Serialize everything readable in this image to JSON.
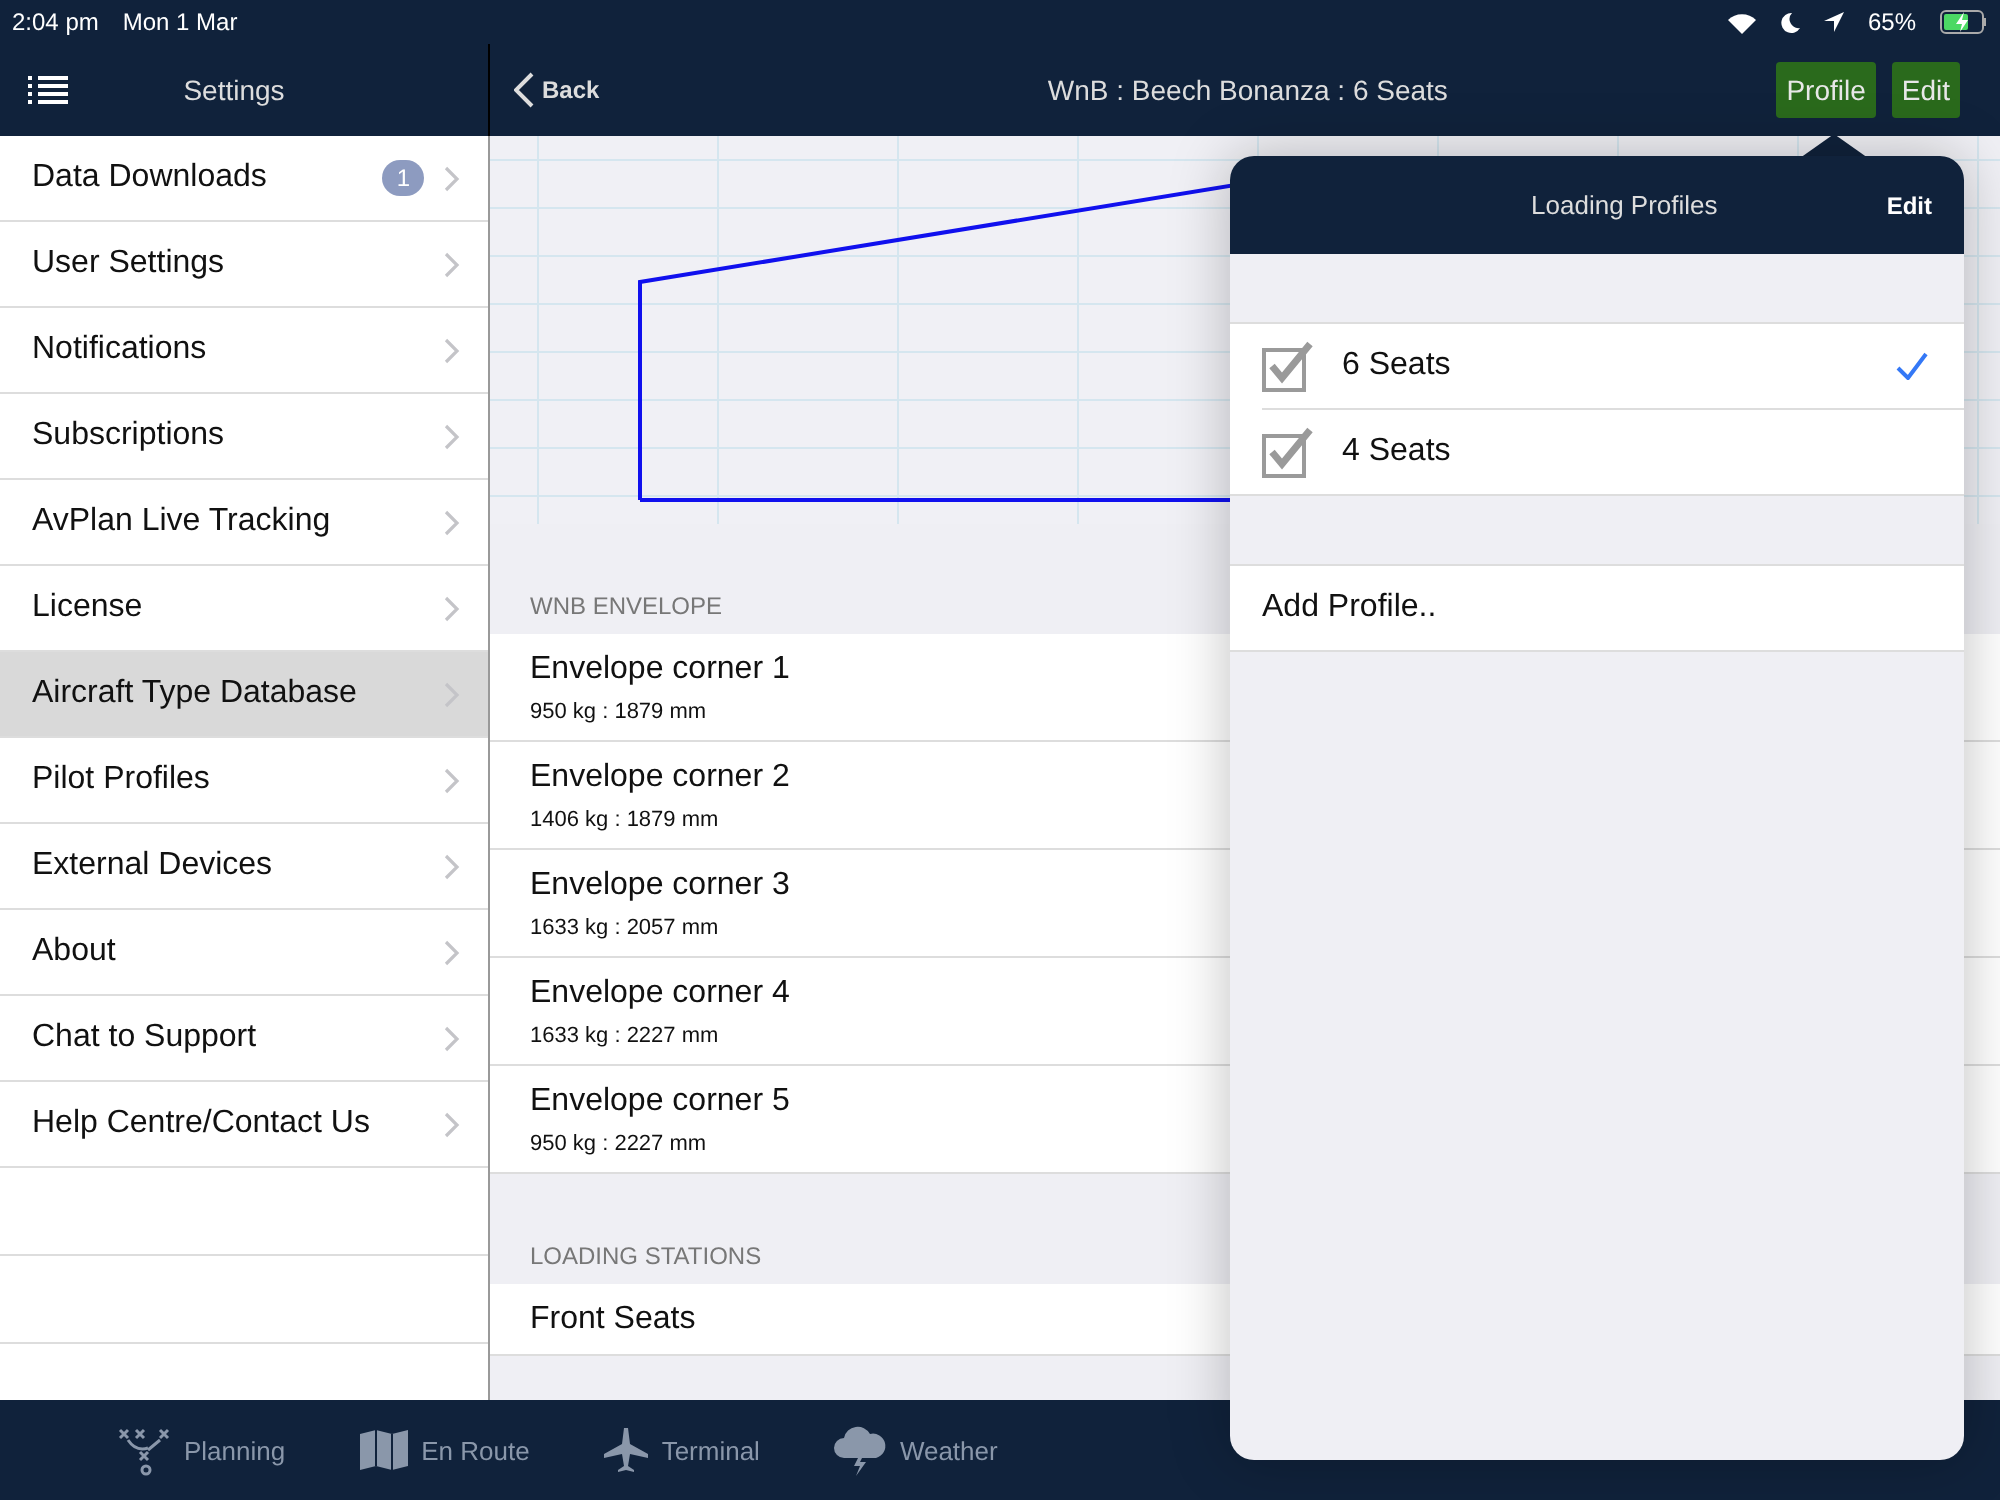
{
  "status_bar": {
    "time": "2:04 pm",
    "date": "Mon 1 Mar",
    "battery": "65%"
  },
  "sidebar": {
    "title": "Settings",
    "items": [
      {
        "label": "Data Downloads",
        "badge": "1",
        "selected": false
      },
      {
        "label": "User Settings",
        "selected": false
      },
      {
        "label": "Notifications",
        "selected": false
      },
      {
        "label": "Subscriptions",
        "selected": false
      },
      {
        "label": "AvPlan Live Tracking",
        "selected": false
      },
      {
        "label": "License",
        "selected": false
      },
      {
        "label": "Aircraft Type Database",
        "selected": true
      },
      {
        "label": "Pilot Profiles",
        "selected": false
      },
      {
        "label": "External Devices",
        "selected": false
      },
      {
        "label": "About",
        "selected": false
      },
      {
        "label": "Chat to Support",
        "selected": false
      },
      {
        "label": "Help Centre/Contact Us",
        "selected": false
      }
    ]
  },
  "nav": {
    "back": "Back",
    "title": "WnB : Beech Bonanza : 6 Seats",
    "buttons": [
      "Profile",
      "Edit"
    ]
  },
  "sections": [
    {
      "header": "WNB ENVELOPE",
      "rows": [
        {
          "title": "Envelope corner 1",
          "subtitle": "950 kg : 1879 mm"
        },
        {
          "title": "Envelope corner 2",
          "subtitle": "1406 kg : 1879 mm"
        },
        {
          "title": "Envelope corner 3",
          "subtitle": "1633 kg : 2057 mm"
        },
        {
          "title": "Envelope corner 4",
          "subtitle": "1633 kg : 2227 mm"
        },
        {
          "title": "Envelope corner 5",
          "subtitle": "950 kg : 2227 mm"
        }
      ]
    },
    {
      "header": "LOADING STATIONS",
      "rows": [
        {
          "title": "Front Seats"
        }
      ]
    }
  ],
  "popover": {
    "title": "Loading Profiles",
    "edit": "Edit",
    "profiles": [
      {
        "label": "6 Seats",
        "checked": true,
        "selected": true
      },
      {
        "label": "4 Seats",
        "checked": true,
        "selected": false
      }
    ],
    "add": "Add Profile.."
  },
  "tab_bar": [
    {
      "label": "Planning",
      "kind": "planning"
    },
    {
      "label": "En Route",
      "kind": "map"
    },
    {
      "label": "Terminal",
      "kind": "plane"
    },
    {
      "label": "Weather",
      "kind": "weather"
    }
  ]
}
